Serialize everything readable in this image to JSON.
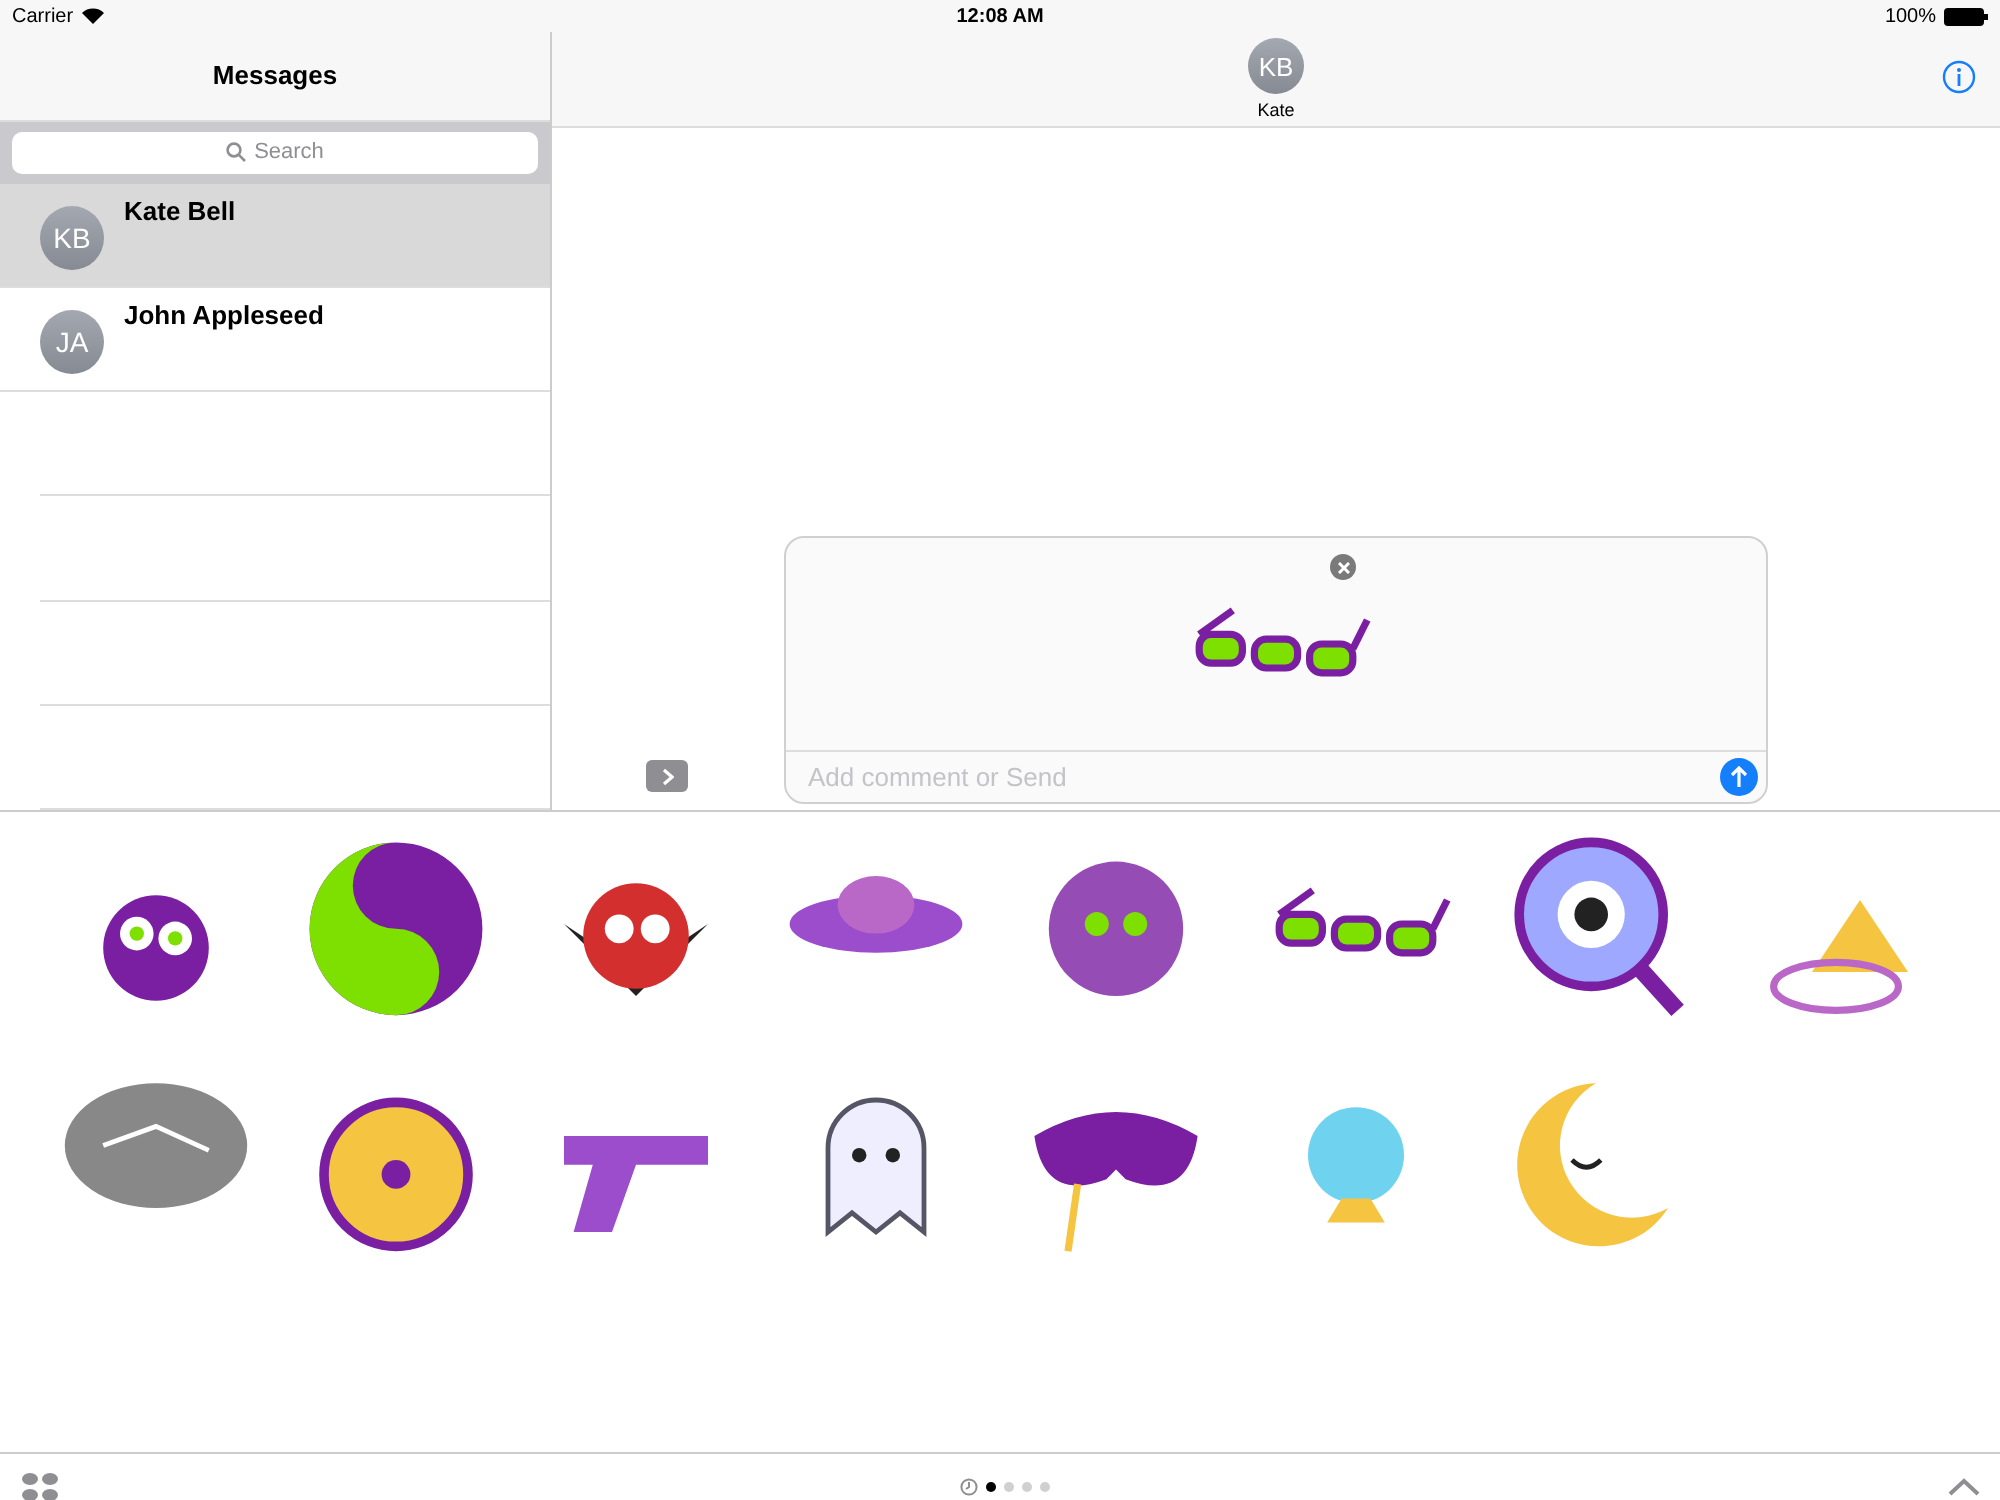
{
  "status_bar": {
    "carrier": "Carrier",
    "time": "12:08 AM",
    "battery": "100%"
  },
  "sidebar": {
    "title": "Messages",
    "search": {
      "placeholder": "Search"
    },
    "conversations": [
      {
        "initials": "KB",
        "name": "Kate Bell",
        "selected": true
      },
      {
        "initials": "JA",
        "name": "John Appleseed",
        "selected": false
      }
    ]
  },
  "conversation": {
    "initials": "KB",
    "name": "Kate"
  },
  "compose": {
    "placeholder": "Add comment or Send",
    "attachment": {
      "kind": "glasses"
    }
  },
  "stickers": [
    {
      "kind": "face"
    },
    {
      "kind": "yinyang"
    },
    {
      "kind": "bat"
    },
    {
      "kind": "ufo"
    },
    {
      "kind": "blob"
    },
    {
      "kind": "glasses"
    },
    {
      "kind": "magnifier"
    },
    {
      "kind": "bell"
    },
    {
      "kind": "chalk"
    },
    {
      "kind": "coin"
    },
    {
      "kind": "revolver"
    },
    {
      "kind": "ghost"
    },
    {
      "kind": "mask"
    },
    {
      "kind": "ball"
    },
    {
      "kind": "moon"
    }
  ],
  "page_dots": [
    {
      "selected": true
    },
    {
      "selected": false
    },
    {
      "selected": false
    },
    {
      "selected": false
    }
  ]
}
